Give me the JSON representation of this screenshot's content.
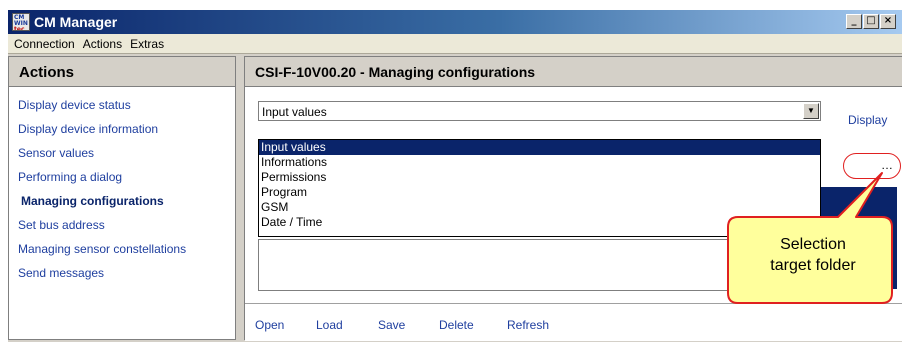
{
  "window": {
    "title": "CM Manager",
    "icon_lines": [
      "CM",
      "WIN",
      "tec"
    ],
    "controls": [
      "_",
      "□",
      "×"
    ]
  },
  "menu": [
    "Connection",
    "Actions",
    "Extras"
  ],
  "left_panel": {
    "title": "Actions",
    "items": [
      "Display device status",
      "Display device information",
      "Sensor values",
      "Performing a dialog",
      "Managing configurations",
      "Set bus address",
      "Managing sensor constellations",
      "Send messages"
    ],
    "active_item": "Managing configurations"
  },
  "right_panel": {
    "title": "CSI-F-10V00.20 - Managing configurations",
    "combo": {
      "value": "Input values",
      "arrow": "▼"
    },
    "display_label": "Display",
    "dropdown_options": [
      "Input values",
      "Informations",
      "Permissions",
      "Program",
      "GSM",
      "Date / Time"
    ],
    "selected_option": "Input values",
    "browse_label": "…",
    "buttons": [
      "Open",
      "Load",
      "Save",
      "Delete",
      "Refresh"
    ]
  },
  "callout": {
    "text_line1": "Selection",
    "text_line2": "target folder",
    "fill": "#ffff9c",
    "stroke": "#e02020"
  }
}
